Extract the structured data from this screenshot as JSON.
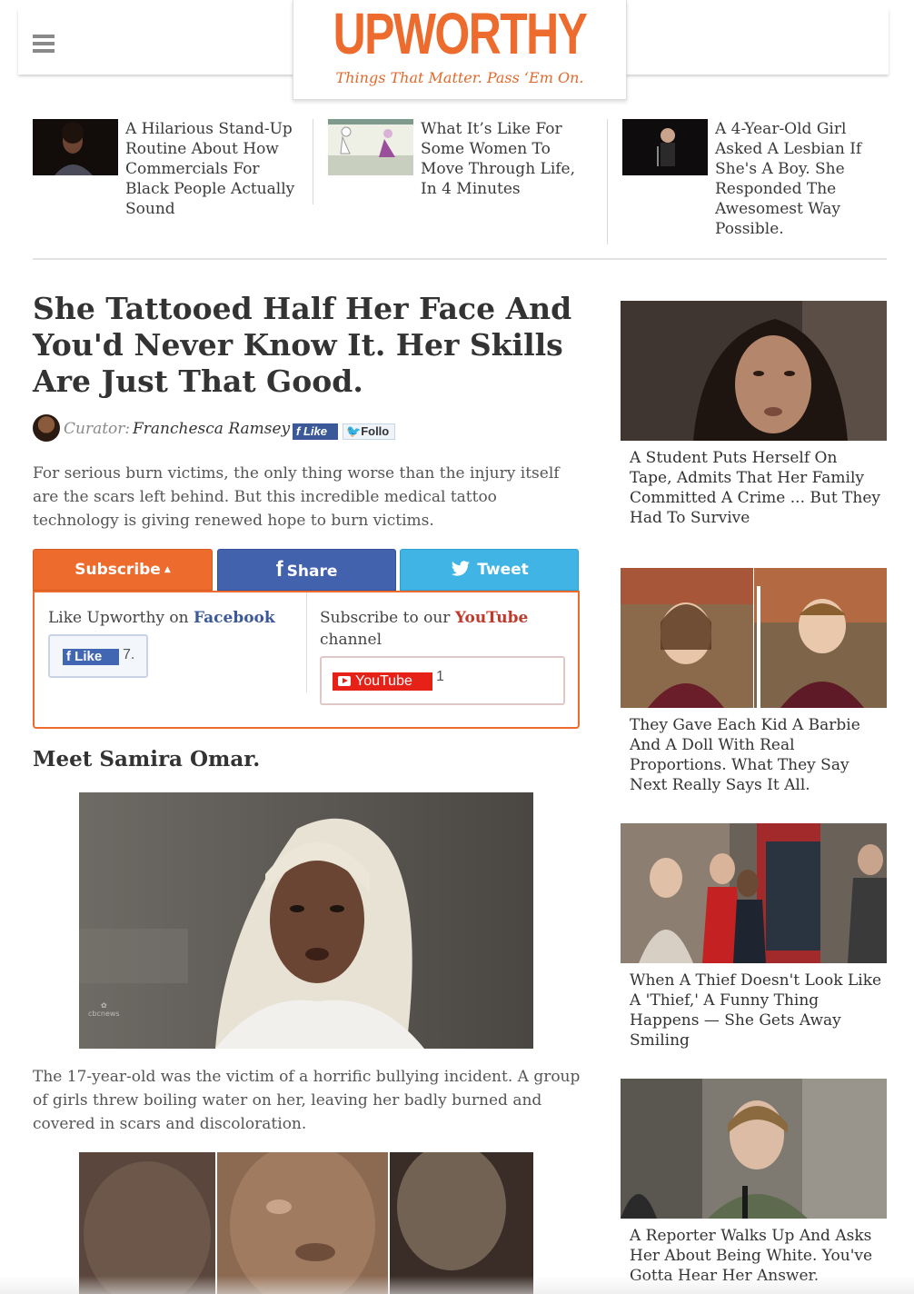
{
  "header": {
    "logo": "UPWORTHY",
    "tagline": "Things That Matter. Pass ‘Em On."
  },
  "promos": [
    {
      "title": "A Hilarious Stand-Up Routine About How Commercials For Black People Actually Sound"
    },
    {
      "title": "What It’s Like For Some Women To Move Through Life, In 4 Minutes"
    },
    {
      "title": "A 4-Year-Old Girl Asked A Lesbian If She's A Boy. She Responded The Awesomest Way Possible."
    }
  ],
  "article": {
    "title": "She Tattooed Half Her Face And You'd Never Know It. Her Skills Are Just That Good.",
    "curator_label": "Curator:",
    "curator_name": "Franchesca Ramsey",
    "mini_like": "Like",
    "mini_follow": "Follo",
    "intro": "For serious burn victims, the only thing worse than the injury itself are the scars left behind. But this incredible medical tattoo technology is giving renewed hope to burn victims.",
    "section_head": "Meet Samira Omar.",
    "body": "The 17-year-old was the victim of a horrific bullying incident. A group of girls threw boiling water on her, leaving her badly burned and covered in scars and discoloration.",
    "image_watermark": "cbcnews"
  },
  "share": {
    "subscribe_label": "Subscribe",
    "share_label": "Share",
    "tweet_label": "Tweet",
    "fb_text": "Like Upworthy on",
    "fb_brand": "Facebook",
    "fb_like": "Like",
    "fb_count": "7.",
    "yt_text_pre": "Subscribe to our",
    "yt_brand": "YouTube",
    "yt_text_post": "channel",
    "yt_button": "YouTube",
    "yt_count": "1"
  },
  "sidebar": [
    {
      "title": "A Student Puts Herself On Tape, Admits That Her Family Committed A Crime ... But They Had To Survive"
    },
    {
      "title": "They Gave Each Kid A Barbie And A Doll With Real Proportions. What They Say Next Really Says It All."
    },
    {
      "title": "When A Thief Doesn't Look Like A 'Thief,' A Funny Thing Happens — She Gets Away Smiling"
    },
    {
      "title": "A Reporter Walks Up And Asks Her About Being White. You've Gotta Hear Her Answer."
    }
  ],
  "colors": {
    "brand_orange": "#ec6b2d",
    "facebook_blue": "#4262ae",
    "twitter_blue": "#41b4e6",
    "youtube_red": "#e62117"
  }
}
